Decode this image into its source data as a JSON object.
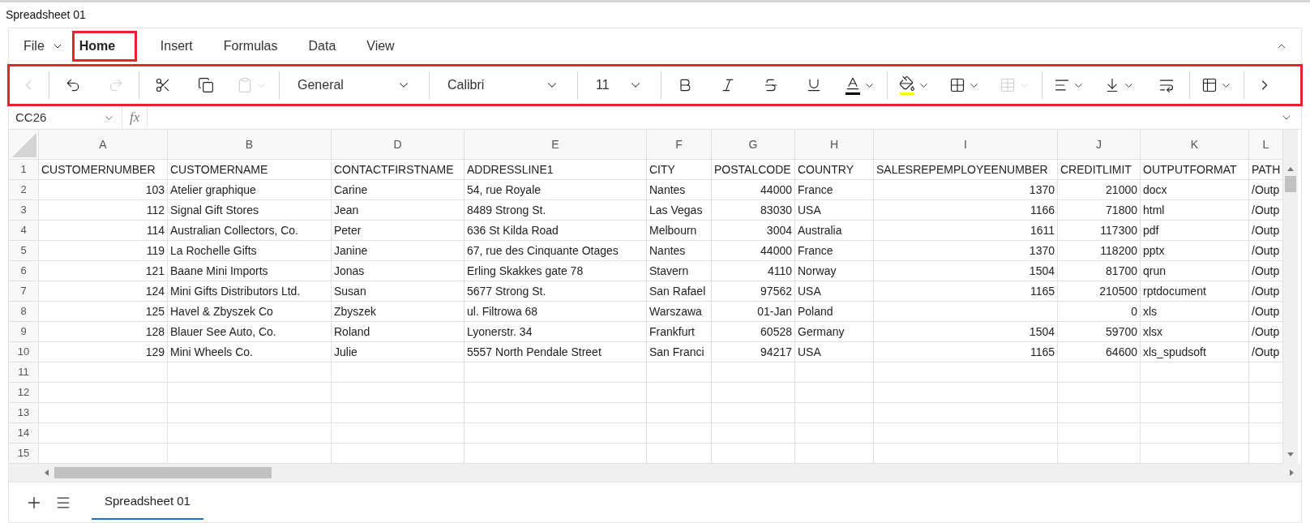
{
  "title": "Spreadsheet 01",
  "file_menu": "File",
  "ribbon_tabs": [
    {
      "label": "Home",
      "selected": true,
      "highlighted": true
    },
    {
      "label": "Insert",
      "selected": false,
      "highlighted": false
    },
    {
      "label": "Formulas",
      "selected": false,
      "highlighted": false
    },
    {
      "label": "Data",
      "selected": false,
      "highlighted": false
    },
    {
      "label": "View",
      "selected": false,
      "highlighted": false
    }
  ],
  "toolbar": {
    "highlighted": true,
    "number_format": "General",
    "font": "Calibri",
    "font_size": "11",
    "buttons": [
      {
        "disabled": true
      },
      {
        "disabled": false
      },
      {
        "disabled": true
      },
      {
        "disabled": false
      },
      {
        "disabled": false
      },
      {
        "disabled": true
      },
      {
        "disabled": false
      },
      {
        "disabled": false
      },
      {
        "disabled": false
      },
      {
        "disabled": false
      },
      {
        "disabled": false,
        "color": "#000000"
      },
      {
        "disabled": false,
        "color": "#ffff00"
      },
      {
        "disabled": false
      },
      {
        "disabled": true
      },
      {
        "disabled": false
      },
      {
        "disabled": false
      },
      {
        "disabled": false
      },
      {
        "disabled": false
      },
      {
        "disabled": false
      }
    ]
  },
  "formula_bar": {
    "name_box": "CC26",
    "fx": "fx"
  },
  "grid": {
    "columns": [
      {
        "letter": "A",
        "kind": "number"
      },
      {
        "letter": "B",
        "kind": "text"
      },
      {
        "letter": "D",
        "kind": "text"
      },
      {
        "letter": "E",
        "kind": "text"
      },
      {
        "letter": "F",
        "kind": "text"
      },
      {
        "letter": "G",
        "kind": "number"
      },
      {
        "letter": "H",
        "kind": "text"
      },
      {
        "letter": "I",
        "kind": "number"
      },
      {
        "letter": "J",
        "kind": "number"
      },
      {
        "letter": "K",
        "kind": "text"
      },
      {
        "letter": "L",
        "kind": "text"
      }
    ],
    "rows": [
      {
        "number": "1",
        "kind": "header",
        "cells": [
          "CUSTOMERNUMBER",
          "CUSTOMERNAME",
          "CONTACTFIRSTNAME",
          "ADDRESSLINE1",
          "CITY",
          "POSTALCODE",
          "COUNTRY",
          "SALESREPEMPLOYEENUMBER",
          "CREDITLIMIT",
          "OUTPUTFORMAT",
          "PATH"
        ]
      },
      {
        "number": "2",
        "kind": "data",
        "cells": [
          "103",
          "Atelier graphique",
          "Carine",
          "54, rue Royale",
          "Nantes",
          "44000",
          "France",
          "1370",
          "21000",
          "docx",
          "/Outp"
        ]
      },
      {
        "number": "3",
        "kind": "data",
        "cells": [
          "112",
          "Signal Gift Stores",
          "Jean",
          "8489 Strong St.",
          "Las Vegas",
          "83030",
          "USA",
          "1166",
          "71800",
          "html",
          "/Outp"
        ]
      },
      {
        "number": "4",
        "kind": "data",
        "cells": [
          "114",
          "Australian Collectors, Co.",
          "Peter",
          "636 St Kilda Road",
          "Melbourn",
          "3004",
          "Australia",
          "1611",
          "117300",
          "pdf",
          "/Outp"
        ]
      },
      {
        "number": "5",
        "kind": "data",
        "cells": [
          "119",
          "La Rochelle Gifts",
          "Janine",
          "67, rue des Cinquante Otages",
          "Nantes",
          "44000",
          "France",
          "1370",
          "118200",
          "pptx",
          "/Outp"
        ]
      },
      {
        "number": "6",
        "kind": "data",
        "cells": [
          "121",
          "Baane Mini Imports",
          "Jonas",
          "Erling Skakkes gate 78",
          "Stavern",
          "4110",
          "Norway",
          "1504",
          "81700",
          "qrun",
          "/Outp"
        ]
      },
      {
        "number": "7",
        "kind": "data",
        "cells": [
          "124",
          "Mini Gifts Distributors Ltd.",
          "Susan",
          "5677 Strong St.",
          "San Rafael",
          "97562",
          "USA",
          "1165",
          "210500",
          "rptdocument",
          "/Outp"
        ]
      },
      {
        "number": "8",
        "kind": "data",
        "cells": [
          "125",
          "Havel & Zbyszek Co",
          "Zbyszek",
          "ul. Filtrowa 68",
          "Warszawa",
          "01-Jan",
          "Poland",
          null,
          "0",
          "xls",
          "/Outp"
        ]
      },
      {
        "number": "9",
        "kind": "data",
        "cells": [
          "128",
          "Blauer See Auto, Co.",
          "Roland",
          "Lyonerstr. 34",
          "Frankfurt",
          "60528",
          "Germany",
          "1504",
          "59700",
          "xlsx",
          "/Outp"
        ]
      },
      {
        "number": "10",
        "kind": "data",
        "cells": [
          "129",
          "Mini Wheels Co.",
          "Julie",
          "5557 North Pendale Street",
          "San Franci",
          "94217",
          "USA",
          "1165",
          "64600",
          "xls_spudsoft",
          "/Outp"
        ]
      },
      {
        "number": "11",
        "kind": "empty"
      },
      {
        "number": "12",
        "kind": "empty"
      },
      {
        "number": "13",
        "kind": "empty"
      },
      {
        "number": "14",
        "kind": "empty"
      },
      {
        "number": "15",
        "kind": "empty"
      }
    ]
  },
  "sheet_tabs": [
    {
      "label": "Spreadsheet 01",
      "selected": true
    }
  ]
}
